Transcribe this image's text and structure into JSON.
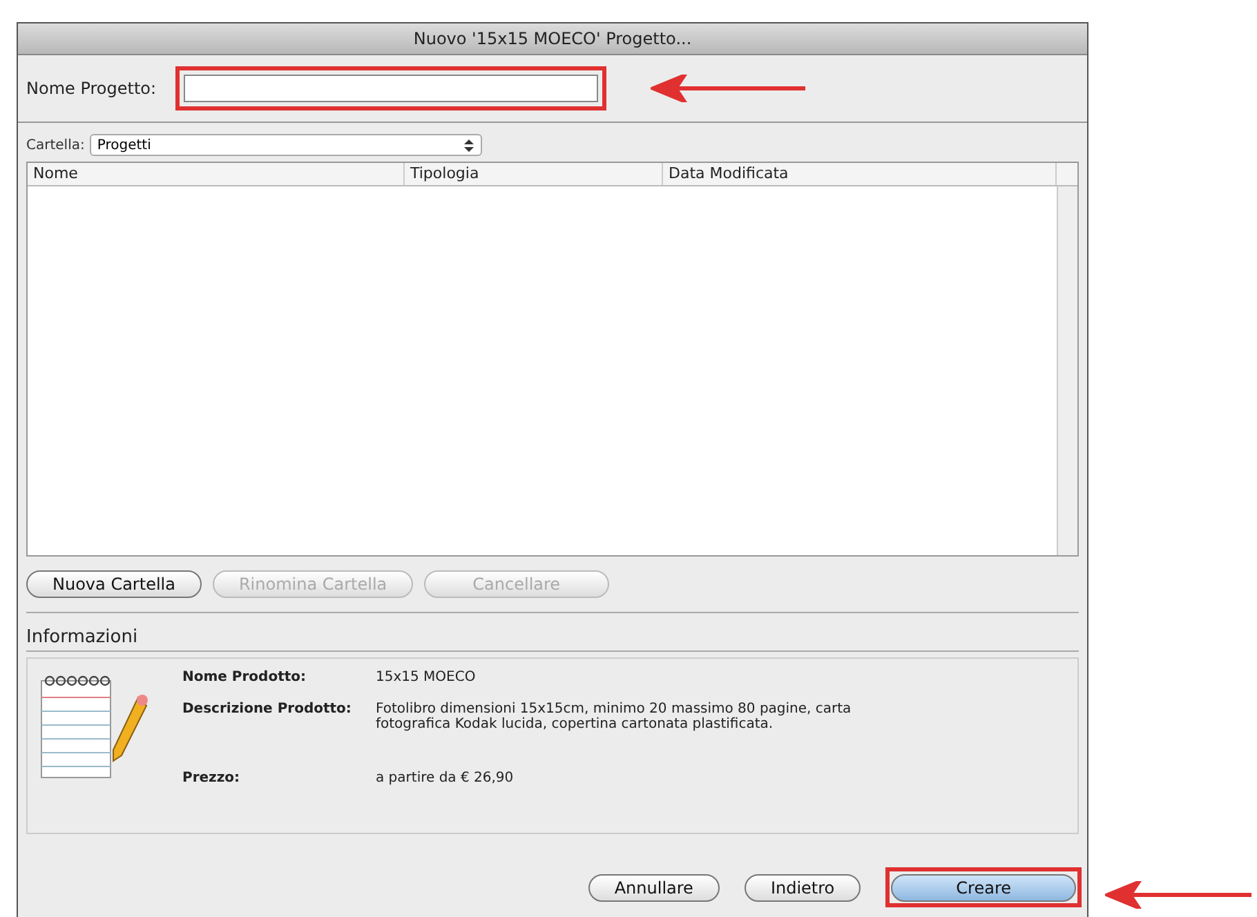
{
  "window": {
    "title": "Nuovo '15x15 MOECO' Progetto..."
  },
  "project_name": {
    "label": "Nome Progetto:"
  },
  "folder": {
    "label": "Cartella:",
    "value": "Progetti"
  },
  "table": {
    "columns": [
      "Nome",
      "Tipologia",
      "Data Modificata"
    ]
  },
  "folder_buttons": [
    {
      "label": "Nuova Cartella",
      "disabled": false
    },
    {
      "label": "Rinomina Cartella",
      "disabled": true
    },
    {
      "label": "Cancellare",
      "disabled": true
    }
  ],
  "info": {
    "title": "Informazioni",
    "fields": [
      {
        "label": "Nome Prodotto:",
        "value": "15x15 MOECO"
      },
      {
        "label": "Descrizione Prodotto:",
        "value": "Fotolibro dimensioni 15x15cm, minimo 20 massimo 80 pagine, carta fotografica Kodak lucida, copertina cartonata plastificata."
      },
      {
        "label": "Prezzo:",
        "value": "a partire da € 26,90"
      }
    ]
  },
  "dialog_buttons": [
    {
      "label": "Annullare",
      "default": false
    },
    {
      "label": "Indietro",
      "default": false
    },
    {
      "label": "Creare",
      "default": true
    }
  ]
}
